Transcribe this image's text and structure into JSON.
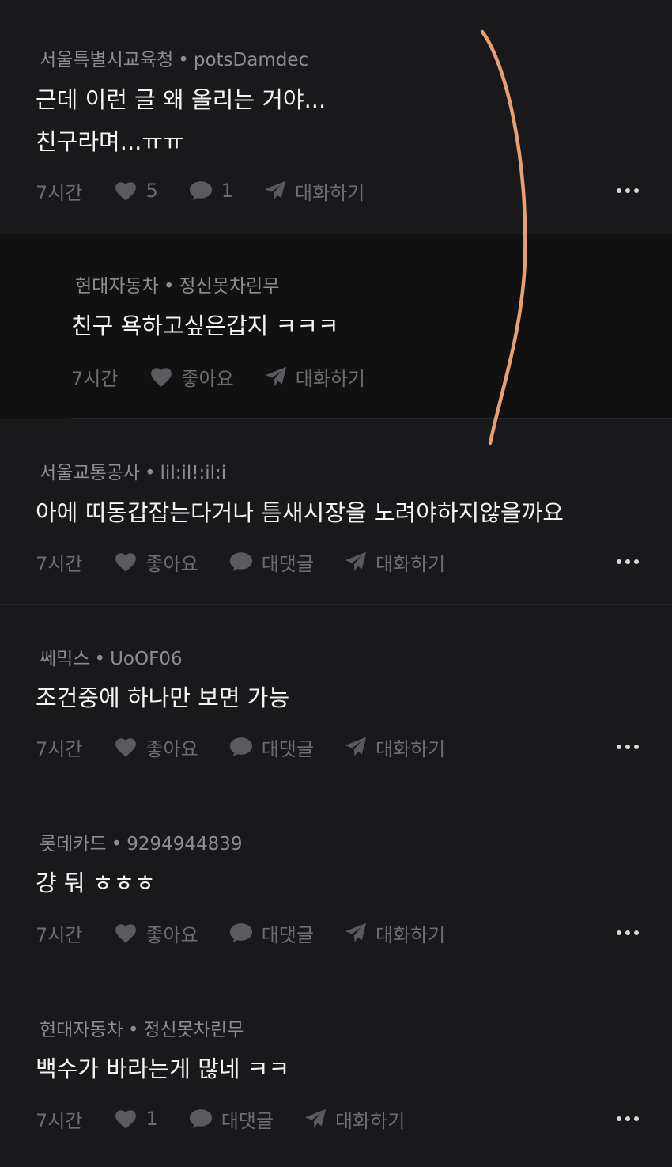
{
  "comments": [
    {
      "org": "서울특별시교육청",
      "user": "potsDamdec",
      "lines": [
        "근데 이런 글 왜 올리는 거야...",
        "친구라며...ㅠㅠ"
      ],
      "time": "7시간",
      "likes": "5",
      "replies": "1",
      "chat": "대화하기"
    },
    {
      "org": "현대자동차",
      "user": "정신못차린무",
      "lines": [
        "친구 욕하고싶은갑지 ㅋㅋㅋ"
      ],
      "time": "7시간",
      "likes": "좋아요",
      "chat": "대화하기"
    },
    {
      "org": "서울교통공사",
      "user": "lil:il!:il:i",
      "lines": [
        "아에 띠동갑잡는다거나 틈새시장을 노려야하지않을까요"
      ],
      "time": "7시간",
      "likes": "좋아요",
      "replies": "대댓글",
      "chat": "대화하기"
    },
    {
      "org": "쎄믹스",
      "user": "UoOF06",
      "lines": [
        "조건중에 하나만 보면 가능"
      ],
      "time": "7시간",
      "likes": "좋아요",
      "replies": "대댓글",
      "chat": "대화하기"
    },
    {
      "org": "롯데카드",
      "user": "9294944839",
      "lines": [
        "걍 둬 ㅎㅎㅎ"
      ],
      "time": "7시간",
      "likes": "좋아요",
      "replies": "대댓글",
      "chat": "대화하기"
    },
    {
      "org": "현대자동차",
      "user": "정신못차린무",
      "lines": [
        "백수가 바라는게 많네 ㅋㅋ"
      ],
      "time": "7시간",
      "likes": "1",
      "replies": "대댓글",
      "chat": "대화하기"
    }
  ],
  "meta": {
    "dot": "•"
  },
  "colors": {
    "background": "#19191b",
    "reply_background": "#111112",
    "annotation_stroke": "#e8a070"
  }
}
